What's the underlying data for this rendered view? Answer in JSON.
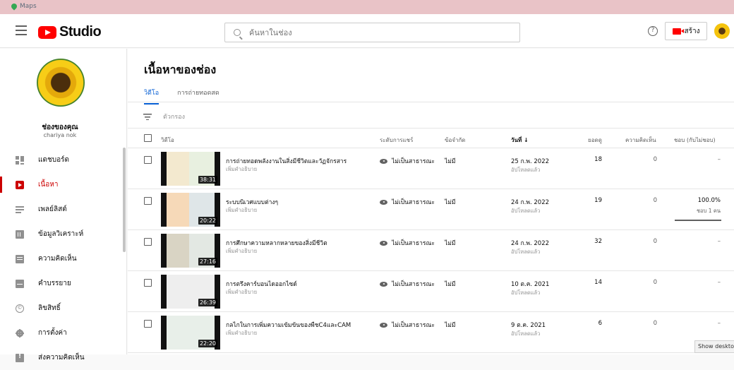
{
  "os_bar": {
    "app_label": "Maps"
  },
  "topbar": {
    "logo_text": "Studio",
    "search_placeholder": "ค้นหาในช่อง",
    "help_glyph": "?",
    "create_label": "สร้าง"
  },
  "sidebar": {
    "channel_title": "ช่องของคุณ",
    "channel_name": "chariya nok",
    "items": [
      {
        "label": "แดชบอร์ด",
        "icon": "dashboard-icon"
      },
      {
        "label": "เนื้อหา",
        "icon": "content-icon",
        "active": true
      },
      {
        "label": "เพลย์ลิสต์",
        "icon": "playlist-icon"
      },
      {
        "label": "ข้อมูลวิเคราะห์",
        "icon": "analytics-icon"
      },
      {
        "label": "ความคิดเห็น",
        "icon": "comments-icon"
      },
      {
        "label": "คำบรรยาย",
        "icon": "subtitles-icon"
      },
      {
        "label": "ลิขสิทธิ์",
        "icon": "copyright-icon"
      },
      {
        "label": "การตั้งค่า",
        "icon": "settings-icon"
      },
      {
        "label": "ส่งความคิดเห็น",
        "icon": "feedback-icon"
      }
    ]
  },
  "main": {
    "page_title": "เนื้อหาของช่อง",
    "tabs": [
      {
        "label": "วิดีโอ",
        "active": true
      },
      {
        "label": "การถ่ายทอดสด"
      }
    ],
    "filter_label": "ตัวกรอง",
    "columns": {
      "video": "วิดีโอ",
      "visibility": "ระดับการแชร์",
      "restrictions": "ข้อจำกัด",
      "date": "วันที่ ↓",
      "views": "ยอดดู",
      "comments": "ความคิดเห็น",
      "likes": "ชอบ (กับไม่ชอบ)"
    },
    "rows": [
      {
        "title": "การถ่ายทอดพลังงานในสิ่งมีชีวิตและวัฏจักรสาร",
        "description": "เพิ่มคำอธิบาย",
        "duration": "38:31",
        "visibility": "ไม่เป็นสาธารณะ",
        "restrictions": "ไม่มี",
        "date": "25 ก.พ. 2022",
        "date_status": "อัปโหลดแล้ว",
        "views": "18",
        "comments": "0",
        "likes": "–",
        "likes_sub": ""
      },
      {
        "title": "ระบบนิเวศแบบต่างๆ",
        "description": "เพิ่มคำอธิบาย",
        "duration": "20:22",
        "visibility": "ไม่เป็นสาธารณะ",
        "restrictions": "ไม่มี",
        "date": "24 ก.พ. 2022",
        "date_status": "อัปโหลดแล้ว",
        "views": "19",
        "comments": "0",
        "likes": "100.0%",
        "likes_sub": "ชอบ 1 คน",
        "like_ratio": 1.0
      },
      {
        "title": "การศึกษาความหลากหลายของสิ่งมีชีวิต",
        "description": "เพิ่มคำอธิบาย",
        "duration": "27:16",
        "visibility": "ไม่เป็นสาธารณะ",
        "restrictions": "ไม่มี",
        "date": "24 ก.พ. 2022",
        "date_status": "อัปโหลดแล้ว",
        "views": "32",
        "comments": "0",
        "likes": "–",
        "likes_sub": ""
      },
      {
        "title": "การตรึงคาร์บอนไดออกไซด์",
        "description": "เพิ่มคำอธิบาย",
        "duration": "26:39",
        "visibility": "ไม่เป็นสาธารณะ",
        "restrictions": "ไม่มี",
        "date": "10 ต.ค. 2021",
        "date_status": "อัปโหลดแล้ว",
        "views": "14",
        "comments": "0",
        "likes": "–",
        "likes_sub": ""
      },
      {
        "title": "กลไกในการเพิ่มความเข้มข้นของพืชC4และCAM",
        "description": "เพิ่มคำอธิบาย",
        "duration": "22:20",
        "visibility": "ไม่เป็นสาธารณะ",
        "restrictions": "ไม่มี",
        "date": "9 ต.ค. 2021",
        "date_status": "อัปโหลดแล้ว",
        "views": "6",
        "comments": "0",
        "likes": "–",
        "likes_sub": ""
      }
    ]
  },
  "tooltip": "Show desktop",
  "colors": {
    "accent": "#cc0000",
    "tab_blue": "#065fd4",
    "os_strip": "#e9c3c7"
  }
}
